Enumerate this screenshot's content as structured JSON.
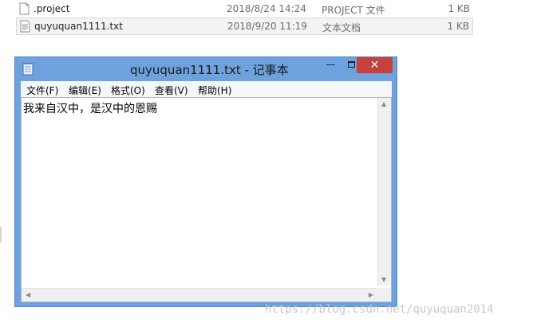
{
  "files": [
    {
      "name": ".project",
      "date": "2018/8/24 14:24",
      "type": "PROJECT 文件",
      "size": "1 KB",
      "selected": false
    },
    {
      "name": "quyuquan1111.txt",
      "date": "2018/9/20 11:19",
      "type": "文本文档",
      "size": "1 KB",
      "selected": true
    }
  ],
  "notepad": {
    "title": "quyuquan1111.txt - 记事本",
    "menu": [
      "文件(F)",
      "编辑(E)",
      "格式(O)",
      "查看(V)",
      "帮助(H)"
    ],
    "content": "我来自汉中，是汉中的恩赐",
    "controls": {
      "minimize": "—",
      "close": "✕"
    }
  },
  "watermark": "https://blog.csdn.net/quyuquan2014",
  "colors": {
    "titlebar": "#6ea2dc",
    "close_button": "#c7403a",
    "menubar": "#f5f6f7"
  }
}
